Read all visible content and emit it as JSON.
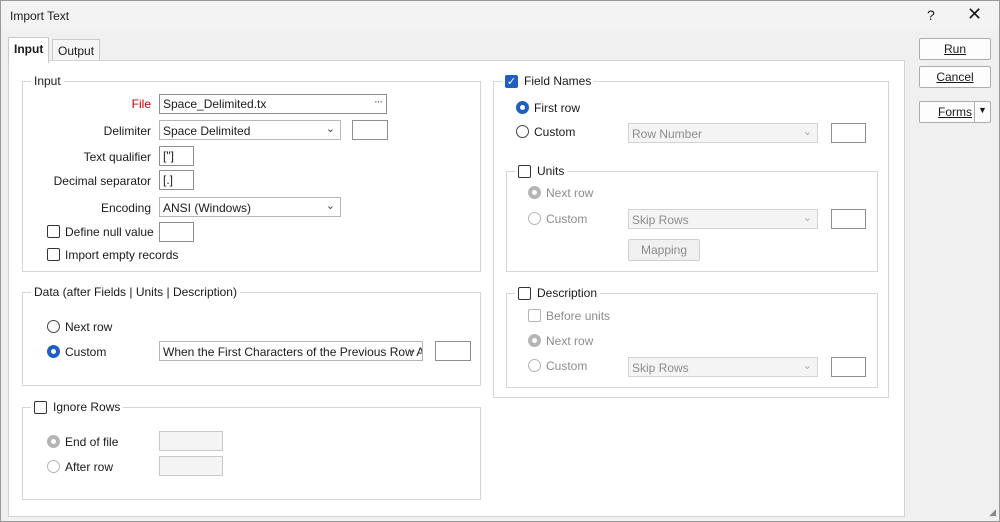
{
  "window": {
    "title": "Import Text",
    "help": "?",
    "close": "✕"
  },
  "tabs": [
    {
      "label": "Input"
    },
    {
      "label": "Output"
    }
  ],
  "buttons": {
    "run": "Run",
    "cancel": "Cancel",
    "forms": "Forms"
  },
  "input_group": {
    "label": "Input",
    "file_label": "File",
    "file_value": "Space_Delimited.tx",
    "delimiter_label": "Delimiter",
    "delimiter_value": "Space Delimited",
    "delimiter_extra": "",
    "text_qualifier_label": "Text qualifier",
    "text_qualifier_value": "[\"]",
    "decimal_label": "Decimal separator",
    "decimal_value": "[.]",
    "encoding_label": "Encoding",
    "encoding_value": "ANSI (Windows)",
    "null_label": "Define null value",
    "empty_label": "Import empty records"
  },
  "data_group": {
    "label": "Data (after Fields | Units | Description)",
    "next_row": "Next row",
    "custom": "Custom",
    "custom_value": "When the First Characters of the Previous Row Are"
  },
  "ignore_group": {
    "label": "Ignore Rows",
    "end_of_file": "End of file",
    "after_row": "After row"
  },
  "field_names": {
    "label": "Field Names",
    "first_row": "First row",
    "custom": "Custom",
    "custom_value": "Row Number"
  },
  "units": {
    "label": "Units",
    "next_row": "Next row",
    "custom": "Custom",
    "custom_value": "Skip Rows",
    "mapping": "Mapping"
  },
  "description": {
    "label": "Description",
    "before_units": "Before units",
    "next_row": "Next row",
    "custom": "Custom",
    "custom_value": "Skip Rows"
  },
  "icons": {
    "dropdown": "chevron-down-icon",
    "browse": "ellipsis-icon",
    "check": "checkmark-icon"
  },
  "colors": {
    "accent": "#1f5fbf",
    "required_label": "#c00000"
  }
}
